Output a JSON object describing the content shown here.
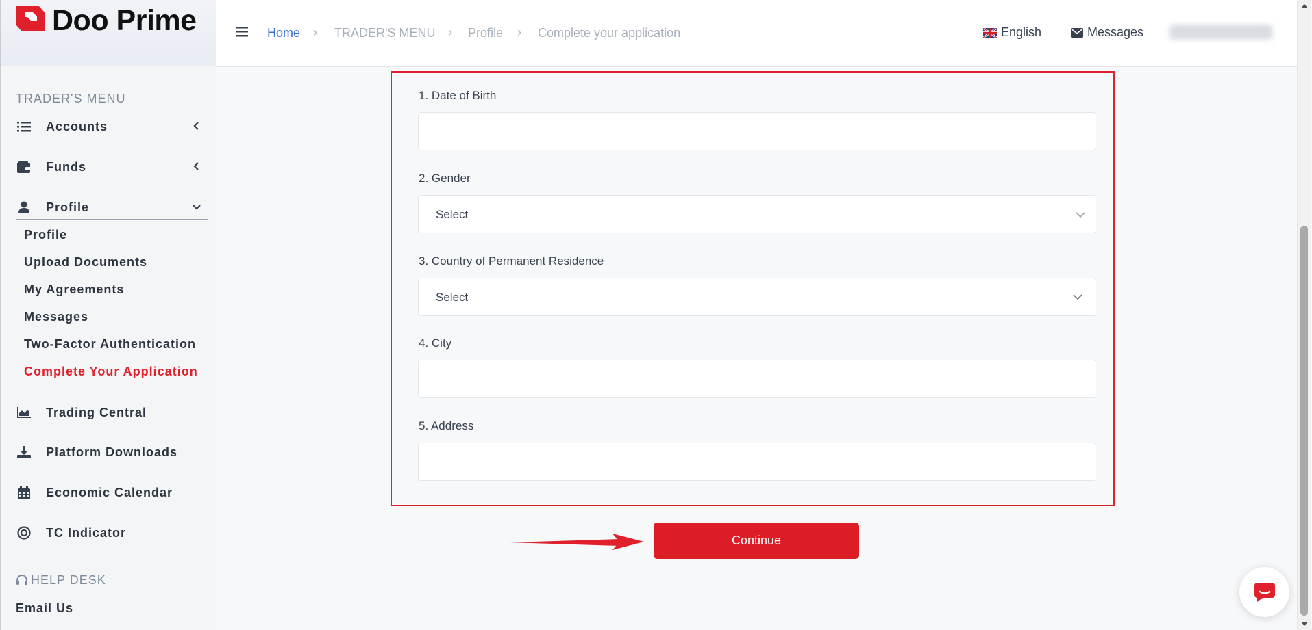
{
  "brand": {
    "name": "Doo Prime",
    "accent_color": "#dd1d25"
  },
  "sidebar": {
    "section_title": "TRADER'S MENU",
    "items": [
      {
        "label": "Accounts",
        "icon": "list-icon",
        "expanded": false
      },
      {
        "label": "Funds",
        "icon": "wallet-icon",
        "expanded": false
      },
      {
        "label": "Profile",
        "icon": "user-icon",
        "expanded": true
      }
    ],
    "profile_subitems": [
      {
        "label": "Profile",
        "active": false
      },
      {
        "label": "Upload Documents",
        "active": false
      },
      {
        "label": "My Agreements",
        "active": false
      },
      {
        "label": "Messages",
        "active": false
      },
      {
        "label": "Two-Factor Authentication",
        "active": false
      },
      {
        "label": "Complete Your Application",
        "active": true
      }
    ],
    "more_items": [
      {
        "label": "Trading Central",
        "icon": "chart-area-icon"
      },
      {
        "label": "Platform Downloads",
        "icon": "download-icon"
      },
      {
        "label": "Economic Calendar",
        "icon": "calendar-icon"
      },
      {
        "label": "TC Indicator",
        "icon": "target-icon"
      }
    ],
    "help_title": "HELP DESK",
    "help_items": [
      {
        "label": "Email Us"
      }
    ]
  },
  "topbar": {
    "breadcrumb": [
      {
        "label": "Home",
        "link": true
      },
      {
        "label": "TRADER'S MENU",
        "link": false
      },
      {
        "label": "Profile",
        "link": false
      },
      {
        "label": "Complete your application",
        "link": false
      }
    ],
    "language": "English",
    "messages": "Messages"
  },
  "form": {
    "fields": [
      {
        "label": "1. Date of Birth",
        "type": "text",
        "value": ""
      },
      {
        "label": "2. Gender",
        "type": "select",
        "value": "Select"
      },
      {
        "label": "3. Country of Permanent Residence",
        "type": "select-addon",
        "value": "Select"
      },
      {
        "label": "4. City",
        "type": "text",
        "value": ""
      },
      {
        "label": "5. Address",
        "type": "text",
        "value": ""
      }
    ],
    "continue_label": "Continue"
  }
}
